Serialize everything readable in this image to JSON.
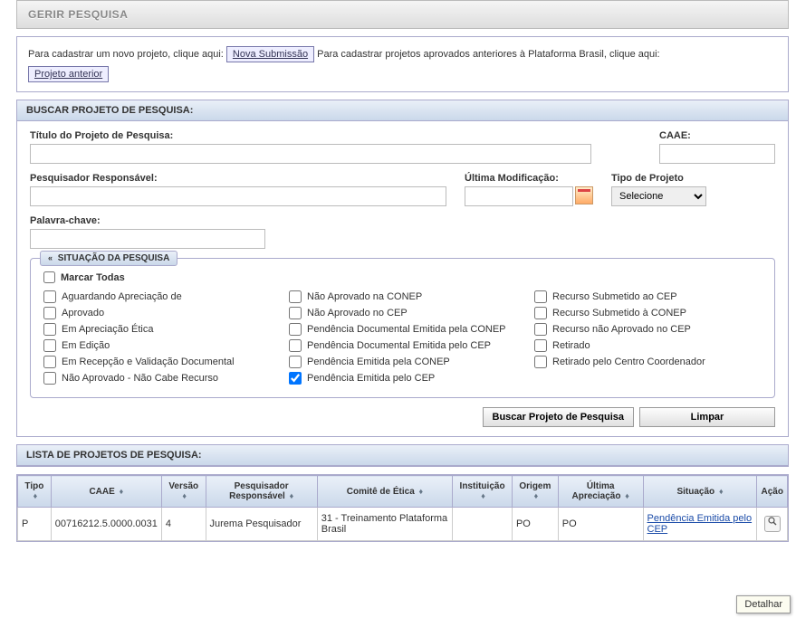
{
  "header": {
    "title": "GERIR PESQUISA"
  },
  "info": {
    "text1": "Para cadastrar um novo projeto, clique aqui:",
    "btn1": "Nova Submissão",
    "text2": "Para cadastrar projetos aprovados anteriores à Plataforma Brasil, clique aqui:",
    "btn2": "Projeto anterior"
  },
  "search_panel": {
    "title": "BUSCAR PROJETO DE PESQUISA:",
    "labels": {
      "titulo": "Título do Projeto de Pesquisa:",
      "caae": "CAAE:",
      "pesquisador": "Pesquisador Responsável:",
      "ultima_mod": "Última Modificação:",
      "tipo_projeto": "Tipo de Projeto",
      "palavra_chave": "Palavra-chave:"
    },
    "tipo_placeholder": "Selecione"
  },
  "situacao": {
    "title": "SITUAÇÃO DA PESQUISA",
    "marcar_todas": "Marcar Todas",
    "col1": [
      "Aguardando Apreciação de",
      "Aprovado",
      "Em Apreciação Ética",
      "Em Edição",
      "Em Recepção e Validação Documental",
      "Não Aprovado - Não Cabe Recurso"
    ],
    "col2": [
      "Não Aprovado na CONEP",
      "Não Aprovado no CEP",
      "Pendência Documental Emitida pela CONEP",
      "Pendência Documental Emitida pelo CEP",
      "Pendência Emitida pela CONEP",
      "Pendência Emitida pelo CEP"
    ],
    "col3": [
      "Recurso Submetido ao CEP",
      "Recurso Submetido à CONEP",
      "Recurso não Aprovado no CEP",
      "Retirado",
      "Retirado pelo Centro Coordenador"
    ],
    "checked_index": [
      1,
      5
    ]
  },
  "buttons": {
    "buscar": "Buscar Projeto de Pesquisa",
    "limpar": "Limpar"
  },
  "list_panel": {
    "title": "LISTA DE PROJETOS DE PESQUISA:",
    "headers": [
      "Tipo",
      "CAAE",
      "Versão",
      "Pesquisador Responsável",
      "Comitê de Ética",
      "Instituição",
      "Origem",
      "Última Apreciação",
      "Situação",
      "Ação"
    ],
    "row": {
      "tipo": "P",
      "caae": "00716212.5.0000.0031",
      "versao": "4",
      "pesquisador": "Jurema Pesquisador",
      "comite": "31 - Treinamento Plataforma Brasil",
      "instituicao": "",
      "origem": "PO",
      "ultima": "PO",
      "situacao": "Pendência Emitida pelo CEP"
    }
  },
  "tooltip": "Detalhar"
}
